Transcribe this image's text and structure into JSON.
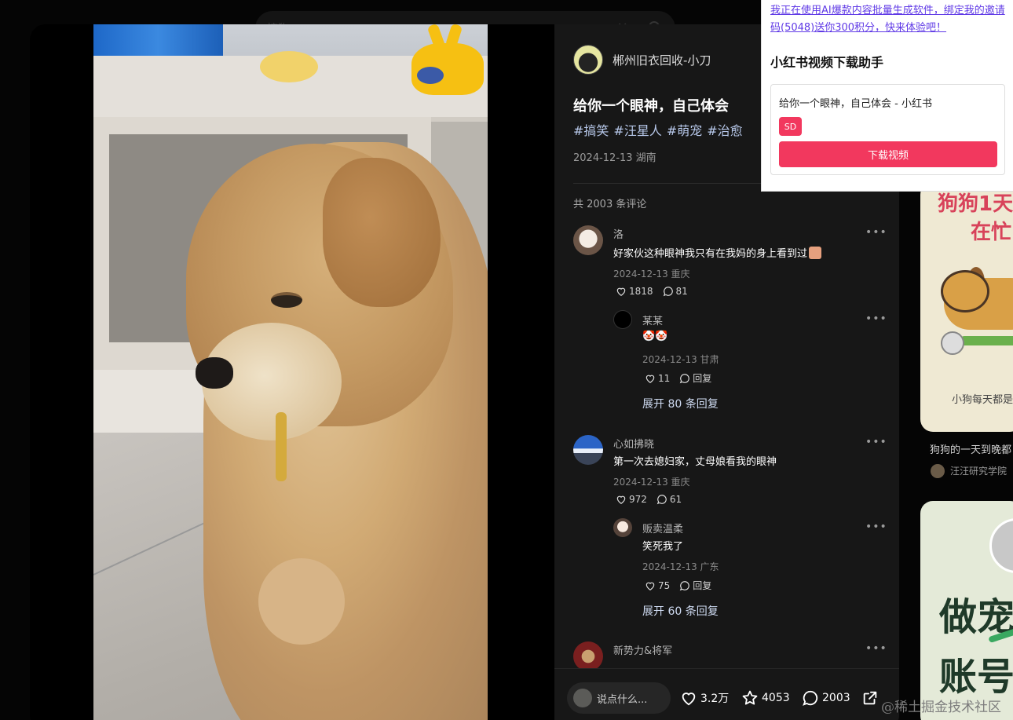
{
  "background": {
    "search_text": "搞狗",
    "card1": {
      "big_line1": "狗狗1天",
      "big_line2": "在忙",
      "caption": "小狗每天都是",
      "title": "狗狗的一天到晚都",
      "author": "汪汪研究学院"
    },
    "card2": {
      "big_line1": "做宠",
      "big_line2": "账号"
    },
    "watermark": "@稀土掘金技术社区"
  },
  "note": {
    "author": "郴州旧衣回收-小刀",
    "title": "给你一个眼神，自己体会",
    "tags": [
      "#搞笑",
      "#汪星人",
      "#萌宠",
      "#治愈"
    ],
    "date": "2024-12-13 湖南",
    "comment_count": "共 2003 条评论",
    "comments": [
      {
        "name": "洛",
        "text": "好家伙这种眼神我只有在我妈的身上看到过",
        "meta": "2024-12-13 重庆",
        "likes": "1818",
        "replies": "81",
        "reply": {
          "name": "某某",
          "text": "🤡🤡",
          "meta": "2024-12-13 甘肃",
          "likes": "11",
          "reply_label": "回复"
        },
        "expand": "展开 80 条回复"
      },
      {
        "name": "心如拂晓",
        "text": "第一次去媳妇家，丈母娘看我的眼神",
        "meta": "2024-12-13 重庆",
        "likes": "972",
        "replies": "61",
        "reply": {
          "name": "贩卖温柔",
          "text": "笑死我了",
          "meta": "2024-12-13 广东",
          "likes": "75",
          "reply_label": "回复"
        },
        "expand": "展开 60 条回复"
      },
      {
        "name": "新势力&将军"
      }
    ],
    "bottom": {
      "placeholder": "说点什么...",
      "likes": "3.2万",
      "collects": "4053",
      "comments": "2003"
    }
  },
  "popup": {
    "promo": "我正在使用AI爆款内容批量生成软件，绑定我的邀请码(5048)送你300积分，快来体验吧！",
    "title": "小红书视频下载助手",
    "card_title": "给你一个眼神，自己体会 - 小红书",
    "badge": "SD",
    "button": "下载视频"
  },
  "colors": {
    "accent": "#f2385e",
    "link": "#5f39e6",
    "tag": "#b7c8ea"
  }
}
